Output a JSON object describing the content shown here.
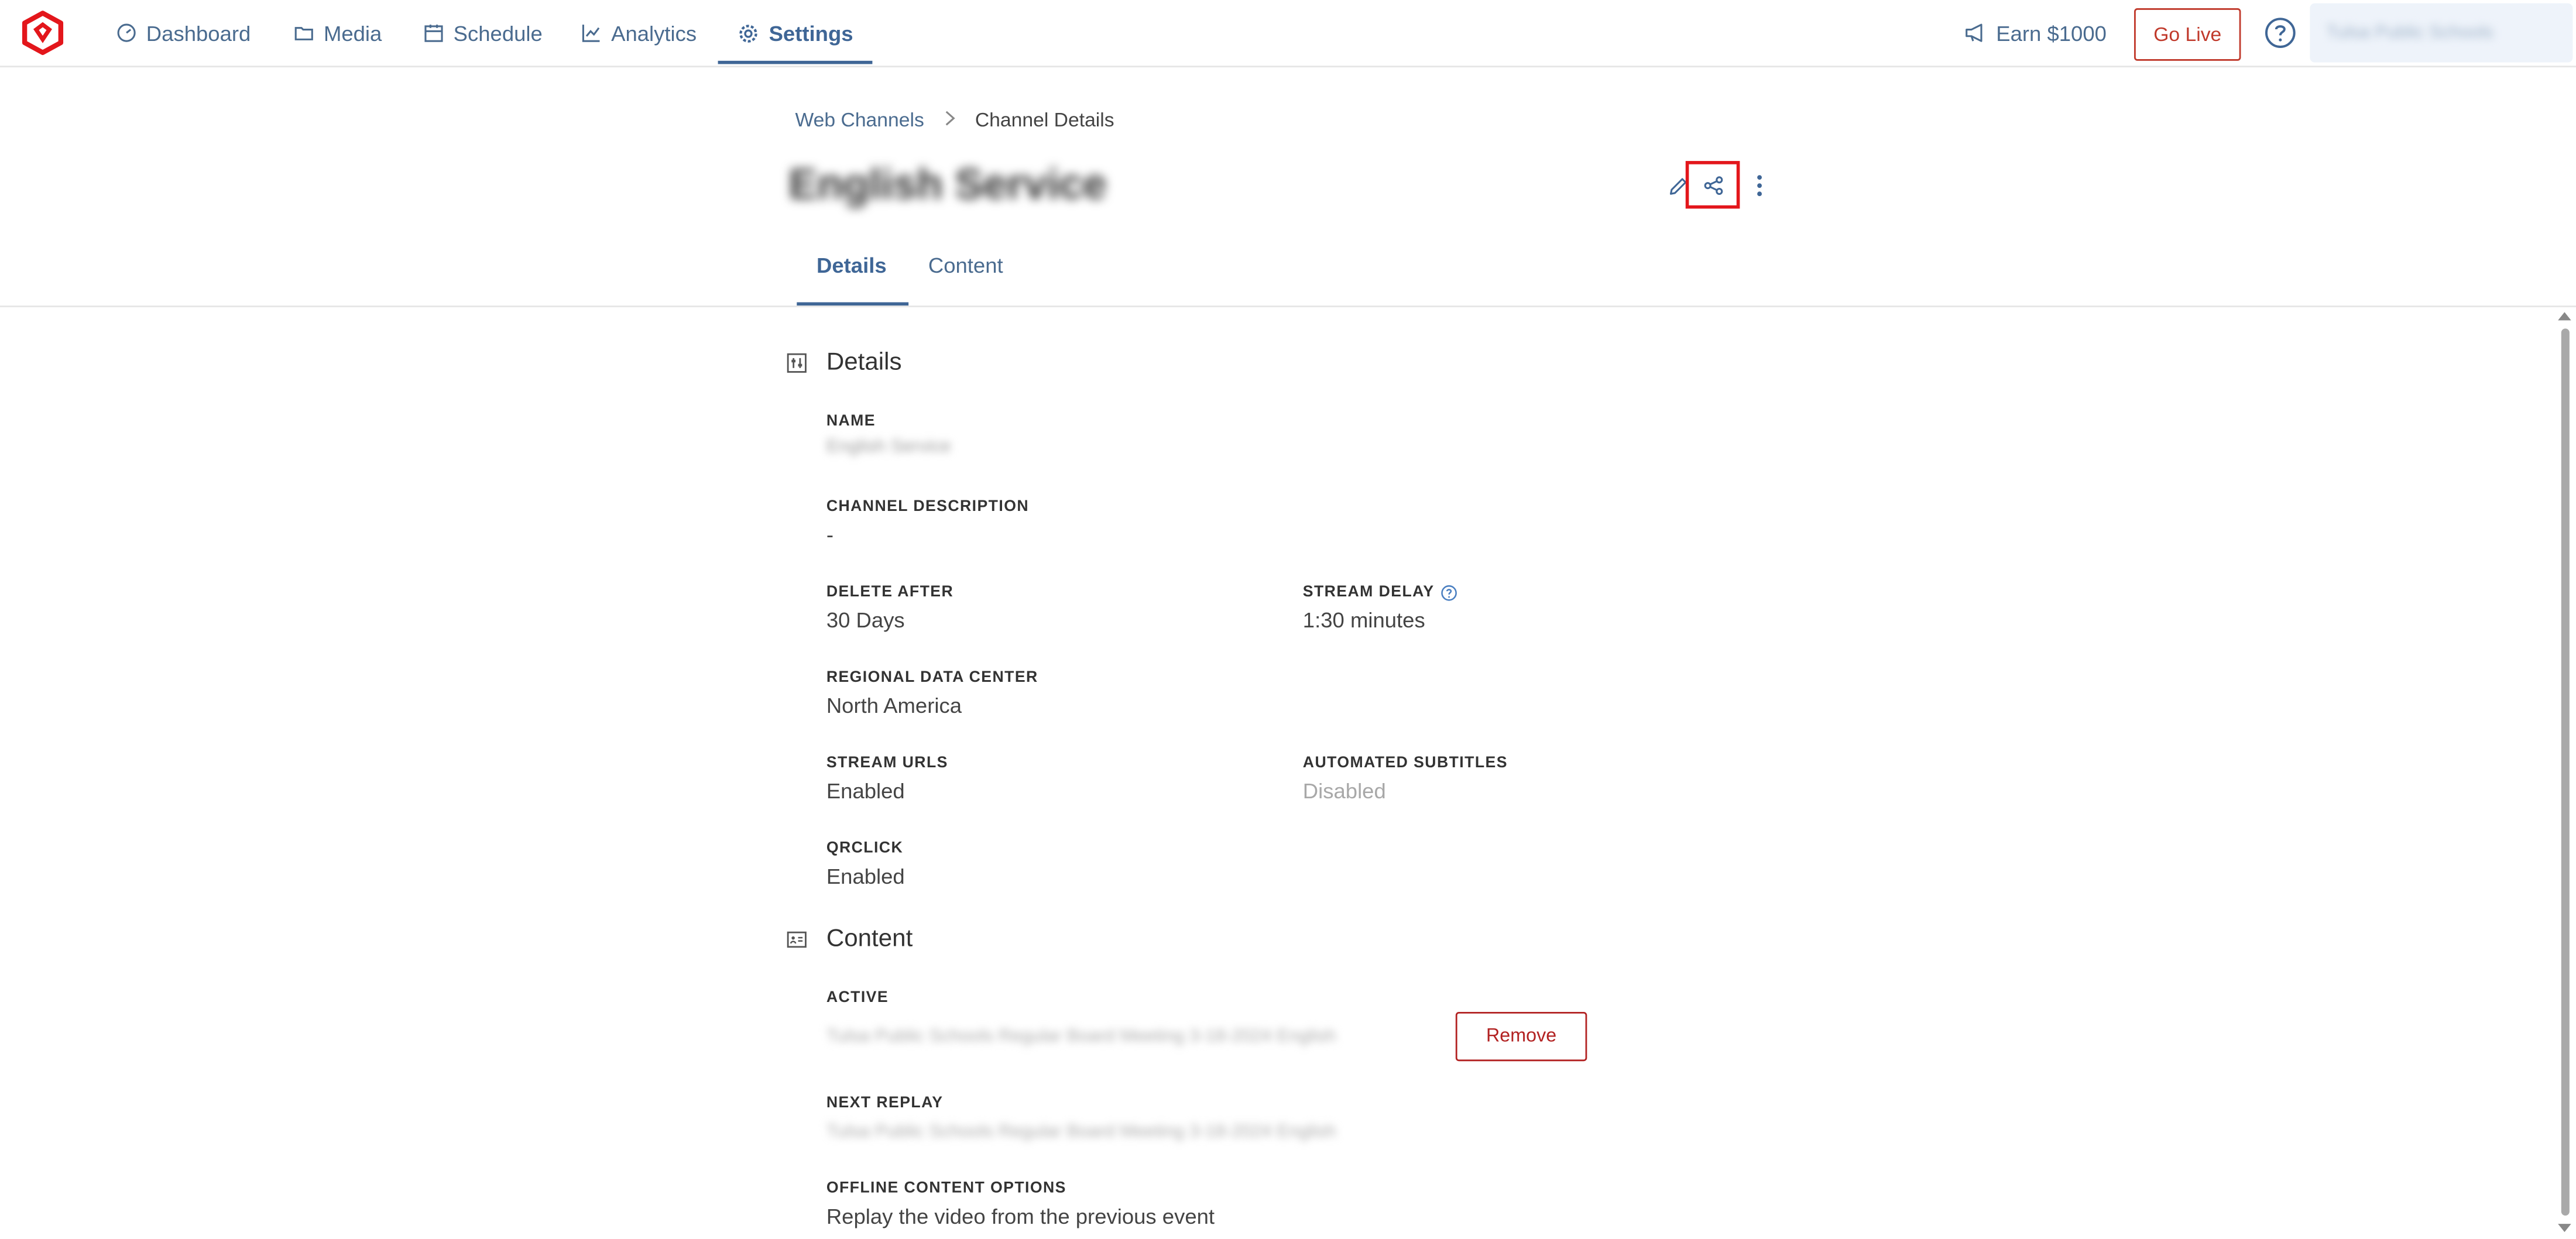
{
  "nav": {
    "items": [
      {
        "label": "Dashboard",
        "icon": "gauge-icon"
      },
      {
        "label": "Media",
        "icon": "folder-icon"
      },
      {
        "label": "Schedule",
        "icon": "calendar-icon"
      },
      {
        "label": "Analytics",
        "icon": "line-chart-icon"
      },
      {
        "label": "Settings",
        "icon": "gear-icon",
        "active": true
      }
    ],
    "earn_label": "Earn $1000",
    "golive_label": "Go Live",
    "org_name": "Tulsa Public Schools"
  },
  "breadcrumb": {
    "parent": "Web Channels",
    "current": "Channel Details"
  },
  "page": {
    "title": "English Service"
  },
  "tabs": [
    {
      "label": "Details",
      "active": true
    },
    {
      "label": "Content",
      "active": false
    }
  ],
  "details": {
    "section_title": "Details",
    "name_label": "NAME",
    "name_value": "English Service",
    "description_label": "CHANNEL DESCRIPTION",
    "description_value": "-",
    "delete_after_label": "DELETE AFTER",
    "delete_after_value": "30 Days",
    "stream_delay_label": "STREAM DELAY",
    "stream_delay_value": "1:30 minutes",
    "region_label": "REGIONAL DATA CENTER",
    "region_value": "North America",
    "stream_urls_label": "STREAM URLS",
    "stream_urls_value": "Enabled",
    "subtitles_label": "AUTOMATED SUBTITLES",
    "subtitles_value": "Disabled",
    "qrclick_label": "QRCLICK",
    "qrclick_value": "Enabled"
  },
  "content": {
    "section_title": "Content",
    "active_label": "ACTIVE",
    "active_value": "Tulsa Public Schools Regular Board Meeting 3-18-2024 English",
    "remove_label": "Remove",
    "next_replay_label": "NEXT REPLAY",
    "next_replay_value": "Tulsa Public Schools Regular Board Meeting 3-18-2024 English",
    "offline_label": "OFFLINE CONTENT OPTIONS",
    "offline_value": "Replay the video from the previous event"
  },
  "colors": {
    "brand_red": "#e3161b",
    "nav_blue": "#3f6696",
    "remove_red": "#b22222"
  }
}
